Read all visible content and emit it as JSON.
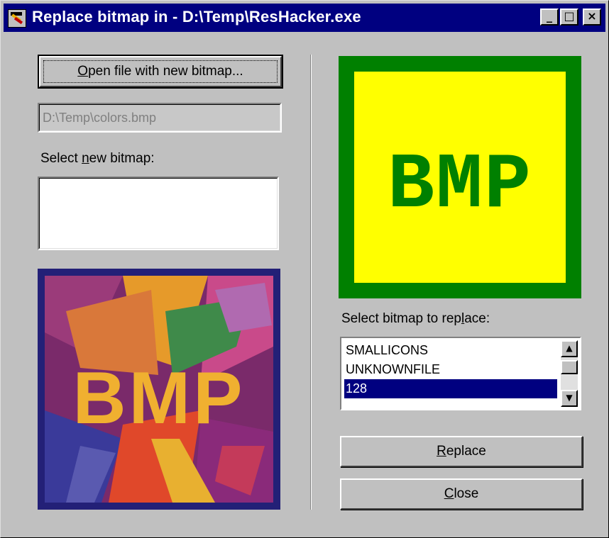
{
  "window": {
    "title": "Replace bitmap in - D:\\Temp\\ResHacker.exe",
    "caption_buttons": {
      "minimize": "_",
      "maximize": "□",
      "close": "×"
    }
  },
  "left": {
    "open_button": {
      "before": "",
      "accel": "O",
      "after": "pen file with new bitmap..."
    },
    "file_path": "D:\\Temp\\colors.bmp",
    "select_new_label": {
      "before": "Select ",
      "accel": "n",
      "after": "ew bitmap:"
    },
    "new_bitmap_preview": {
      "text": "BMP",
      "colors": {
        "bg_dark": "#2a1f6e",
        "text": "#f0b030",
        "accent": "#c83a2a"
      }
    }
  },
  "right": {
    "current_bitmap_preview": {
      "text": "BMP",
      "colors": {
        "frame": "#008000",
        "fill": "#ffff00",
        "text": "#008000"
      }
    },
    "select_replace_label": {
      "before": "Select bitmap to rep",
      "accel": "l",
      "after": "ace:"
    },
    "bitmap_list": {
      "items": [
        "SMALLICONS",
        "UNKNOWNFILE",
        "128"
      ],
      "selected_index": 2
    },
    "replace_button": {
      "before": "",
      "accel": "R",
      "after": "eplace"
    },
    "close_button": {
      "before": "",
      "accel": "C",
      "after": "lose"
    }
  },
  "colors": {
    "face": "#c0c0c0",
    "title_bar": "#000080",
    "selection": "#000080"
  }
}
